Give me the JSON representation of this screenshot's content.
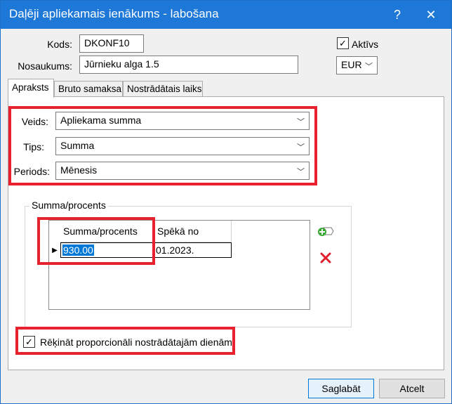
{
  "window": {
    "title": "Daļēji apliekamais ienākums - labošana",
    "help_glyph": "?",
    "close_glyph": "✕"
  },
  "header": {
    "kods_label": "Kods:",
    "kods_value": "DKONF10",
    "nosaukums_label": "Nosaukums:",
    "nosaukums_value": "Jūrnieku alga 1.5",
    "aktivs_label": "Aktīvs",
    "aktivs_checked": true,
    "currency": "EUR"
  },
  "tabs": [
    {
      "label": "Apraksts",
      "active": true
    },
    {
      "label": "Bruto samaksa",
      "active": false
    },
    {
      "label": "Nostrādātais laiks",
      "active": false
    }
  ],
  "form": {
    "veids_label": "Veids:",
    "veids_value": "Apliekama summa",
    "tips_label": "Tips:",
    "tips_value": "Summa",
    "periods_label": "Periods:",
    "periods_value": "Mēnesis"
  },
  "group": {
    "title": "Summa/procents",
    "columns": [
      "Summa/procents",
      "Spēkā no"
    ],
    "rows": [
      {
        "amount": "930.00",
        "from": "01.2023."
      }
    ]
  },
  "proportional": {
    "label": "Rēķināt proporcionāli nostrādātajām dienām",
    "checked": true
  },
  "buttons": {
    "save": "Saglabāt",
    "cancel": "Atcelt"
  },
  "colors": {
    "titlebar": "#1e78d7",
    "highlight": "#e8212e",
    "add_icon": "#3aa935",
    "delete_icon": "#e0202e"
  }
}
